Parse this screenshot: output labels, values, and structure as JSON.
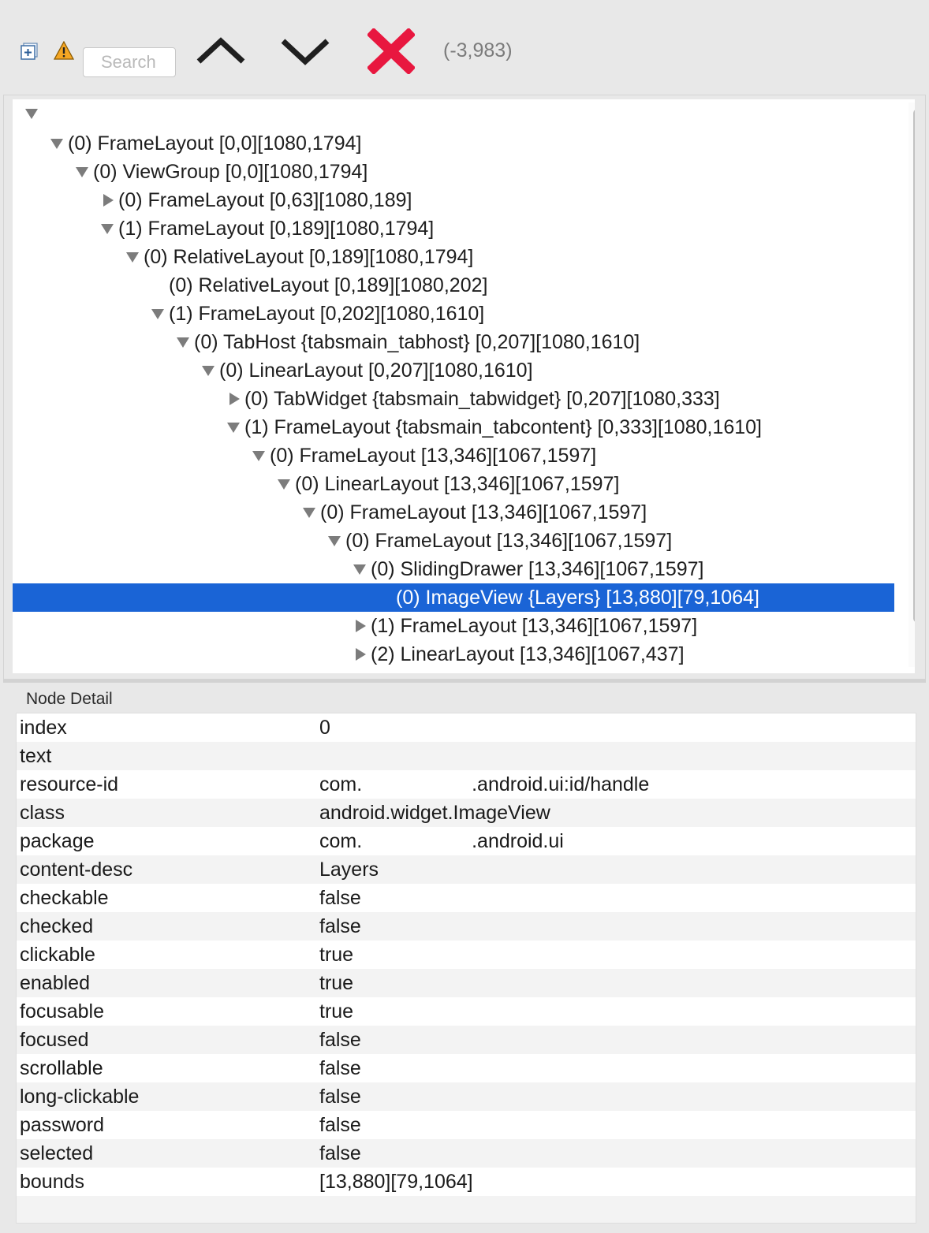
{
  "toolbar": {
    "search_placeholder": "Search",
    "coords": "(-3,983)",
    "icons": [
      "expand-all-icon",
      "warning-icon",
      "chevron-up-icon",
      "chevron-down-icon",
      "close-icon"
    ],
    "colors": {
      "close": "#e8173f",
      "selection": "#1a64d6"
    }
  },
  "tree": {
    "rows": [
      {
        "label": "",
        "expanded": true
      },
      {
        "label": "(0) FrameLayout [0,0][1080,1794]",
        "expanded": true
      },
      {
        "label": "(0) ViewGroup [0,0][1080,1794]",
        "expanded": true
      },
      {
        "label": "(0) FrameLayout [0,63][1080,189]",
        "expanded": false
      },
      {
        "label": "(1) FrameLayout [0,189][1080,1794]",
        "expanded": true
      },
      {
        "label": "(0) RelativeLayout [0,189][1080,1794]",
        "expanded": true
      },
      {
        "label": "(0) RelativeLayout [0,189][1080,202]",
        "expanded": null
      },
      {
        "label": "(1) FrameLayout [0,202][1080,1610]",
        "expanded": true
      },
      {
        "label": "(0) TabHost {tabsmain_tabhost} [0,207][1080,1610]",
        "expanded": true
      },
      {
        "label": "(0) LinearLayout [0,207][1080,1610]",
        "expanded": true
      },
      {
        "label": "(0) TabWidget {tabsmain_tabwidget} [0,207][1080,333]",
        "expanded": false
      },
      {
        "label": "(1) FrameLayout {tabsmain_tabcontent} [0,333][1080,1610]",
        "expanded": true
      },
      {
        "label": "(0) FrameLayout [13,346][1067,1597]",
        "expanded": true
      },
      {
        "label": "(0) LinearLayout [13,346][1067,1597]",
        "expanded": true
      },
      {
        "label": "(0) FrameLayout [13,346][1067,1597]",
        "expanded": true
      },
      {
        "label": "(0) FrameLayout [13,346][1067,1597]",
        "expanded": true
      },
      {
        "label": "(0) SlidingDrawer [13,346][1067,1597]",
        "expanded": true
      },
      {
        "label": "(0) ImageView {Layers} [13,880][79,1064]",
        "expanded": null,
        "selected": true
      },
      {
        "label": "(1) FrameLayout [13,346][1067,1597]",
        "expanded": false
      },
      {
        "label": "(2) LinearLayout [13,346][1067,437]",
        "expanded": false
      }
    ]
  },
  "detail": {
    "title": "Node Detail",
    "rows": [
      {
        "key": "index",
        "value": "0"
      },
      {
        "key": "text",
        "value": ""
      },
      {
        "key": "resource-id",
        "value": "com.                    .android.ui:id/handle"
      },
      {
        "key": "class",
        "value": "android.widget.ImageView"
      },
      {
        "key": "package",
        "value": "com.                    .android.ui"
      },
      {
        "key": "content-desc",
        "value": "Layers"
      },
      {
        "key": "checkable",
        "value": "false"
      },
      {
        "key": "checked",
        "value": "false"
      },
      {
        "key": "clickable",
        "value": "true"
      },
      {
        "key": "enabled",
        "value": "true"
      },
      {
        "key": "focusable",
        "value": "true"
      },
      {
        "key": "focused",
        "value": "false"
      },
      {
        "key": "scrollable",
        "value": "false"
      },
      {
        "key": "long-clickable",
        "value": "false"
      },
      {
        "key": "password",
        "value": "false"
      },
      {
        "key": "selected",
        "value": "false"
      },
      {
        "key": "bounds",
        "value": "[13,880][79,1064]"
      }
    ]
  }
}
